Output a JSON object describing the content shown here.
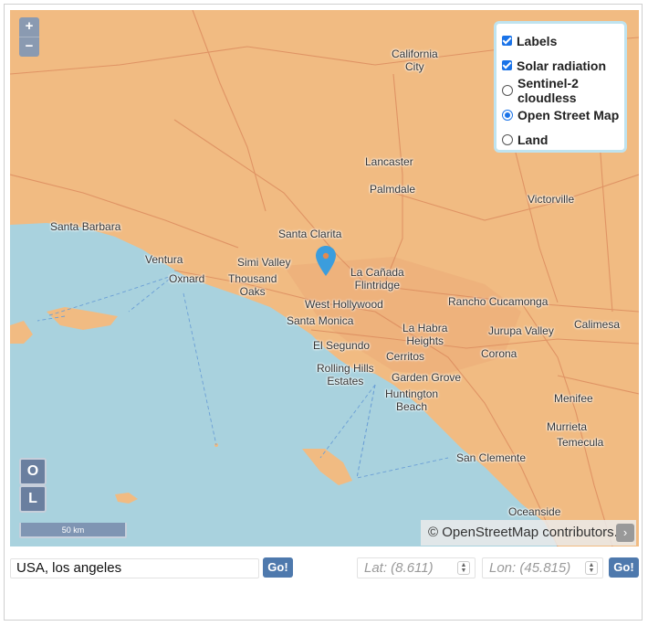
{
  "map": {
    "zoom_in": "+",
    "zoom_out": "−",
    "places": {
      "california_city": "California\nCity",
      "lancaster": "Lancaster",
      "palmdale": "Palmdale",
      "victorville": "Victorville",
      "santa_barbara": "Santa Barbara",
      "santa_clarita": "Santa Clarita",
      "ventura": "Ventura",
      "simi_valley": "Simi Valley",
      "oxnard": "Oxnard",
      "thousand_oaks": "Thousand\nOaks",
      "la_canada": "La Cañada\nFlintridge",
      "rancho_cucamonga": "Rancho Cucamonga",
      "west_hollywood": "West Hollywood",
      "santa_monica": "Santa Monica",
      "la_habra": "La Habra\nHeights",
      "calimesa": "Calimesa",
      "jurupa_valley": "Jurupa Valley",
      "el_segundo": "El Segundo",
      "cerritos": "Cerritos",
      "corona": "Corona",
      "rolling_hills": "Rolling Hills\nEstates",
      "garden_grove": "Garden Grove",
      "huntington_beach": "Huntington\nBeach",
      "menifee": "Menifee",
      "murrieta": "Murrieta",
      "temecula": "Temecula",
      "san_clemente": "San Clemente",
      "oceanside": "Oceanside"
    },
    "layers": [
      {
        "label": "Labels",
        "type": "checkbox",
        "checked": true
      },
      {
        "label": "Solar radiation",
        "type": "checkbox",
        "checked": true
      },
      {
        "label": "Sentinel-2 cloudless",
        "type": "radio",
        "checked": false
      },
      {
        "label": "Open Street Map",
        "type": "radio",
        "checked": true
      },
      {
        "label": "Land",
        "type": "radio",
        "checked": false
      }
    ],
    "button_o": "O",
    "button_l": "L",
    "scale_label": "50 km",
    "attribution": "© OpenStreetMap contributors.",
    "attribution_arrow": "›",
    "colors": {
      "land": "#f1bb82",
      "water": "#a9d2de",
      "accent": "#1a73e8",
      "marker": "#3b9ddd"
    }
  },
  "controls": {
    "search_value": "USA, los angeles",
    "go_label": "Go!",
    "lat_placeholder": "Lat: (8.611)",
    "lon_placeholder": "Lon: (45.815)",
    "go2_label": "Go!",
    "spin_up": "▲",
    "spin_down": "▼"
  }
}
